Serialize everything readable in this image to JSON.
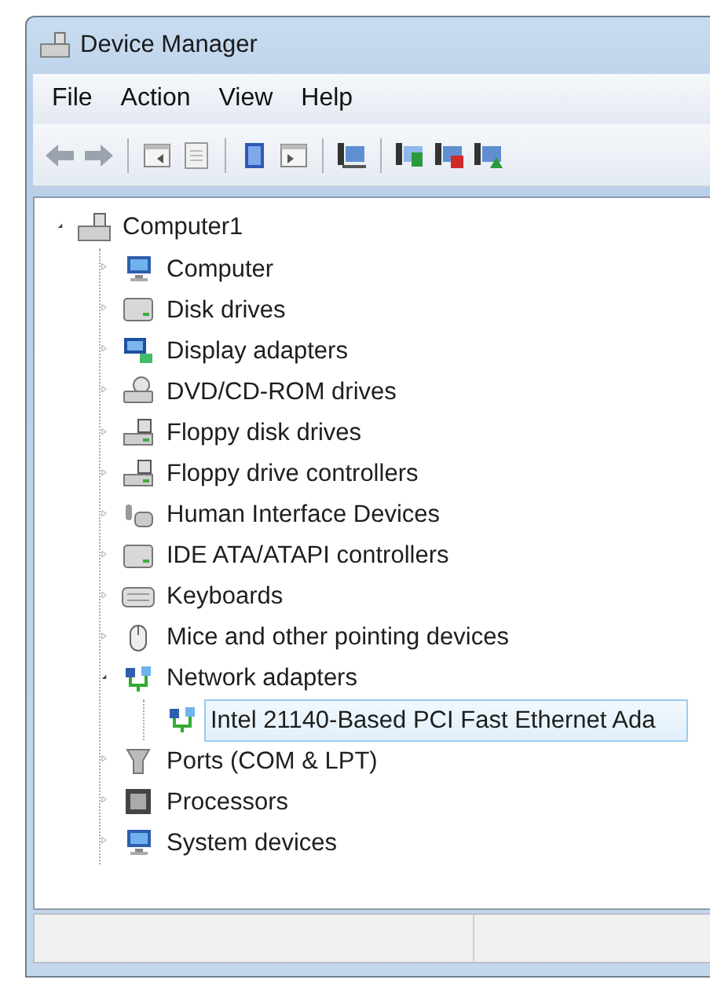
{
  "window": {
    "title": "Device Manager"
  },
  "menu": [
    "File",
    "Action",
    "View",
    "Help"
  ],
  "toolbar": [
    {
      "kind": "back"
    },
    {
      "kind": "forward"
    },
    {
      "kind": "separator"
    },
    {
      "kind": "pane"
    },
    {
      "kind": "properties"
    },
    {
      "kind": "separator"
    },
    {
      "kind": "help"
    },
    {
      "kind": "pane2"
    },
    {
      "kind": "separator"
    },
    {
      "kind": "scan"
    },
    {
      "kind": "separator"
    },
    {
      "kind": "update"
    },
    {
      "kind": "disable"
    },
    {
      "kind": "enable"
    }
  ],
  "tree": [
    {
      "label": "Computer1",
      "kind": "host",
      "expanded": true,
      "selected": false,
      "children": [
        {
          "label": "Computer",
          "kind": "monitor",
          "expanded": false,
          "selected": false
        },
        {
          "label": "Disk drives",
          "kind": "drive",
          "expanded": false,
          "selected": false
        },
        {
          "label": "Display adapters",
          "kind": "display",
          "expanded": false,
          "selected": false
        },
        {
          "label": "DVD/CD-ROM drives",
          "kind": "optical",
          "expanded": false,
          "selected": false
        },
        {
          "label": "Floppy disk drives",
          "kind": "floppy",
          "expanded": false,
          "selected": false
        },
        {
          "label": "Floppy drive controllers",
          "kind": "floppy",
          "expanded": false,
          "selected": false
        },
        {
          "label": "Human Interface Devices",
          "kind": "hid",
          "expanded": false,
          "selected": false
        },
        {
          "label": "IDE ATA/ATAPI controllers",
          "kind": "drive",
          "expanded": false,
          "selected": false
        },
        {
          "label": "Keyboards",
          "kind": "keyboard",
          "expanded": false,
          "selected": false
        },
        {
          "label": "Mice and other pointing devices",
          "kind": "mouse",
          "expanded": false,
          "selected": false
        },
        {
          "label": "Network adapters",
          "kind": "network",
          "expanded": true,
          "selected": false,
          "children": [
            {
              "label": "Intel 21140-Based PCI Fast Ethernet Ada",
              "kind": "network",
              "selected": true
            }
          ]
        },
        {
          "label": "Ports (COM & LPT)",
          "kind": "port",
          "expanded": false,
          "selected": false
        },
        {
          "label": "Processors",
          "kind": "chip",
          "expanded": false,
          "selected": false
        },
        {
          "label": "System devices",
          "kind": "monitor",
          "expanded": false,
          "selected": false
        }
      ]
    }
  ]
}
